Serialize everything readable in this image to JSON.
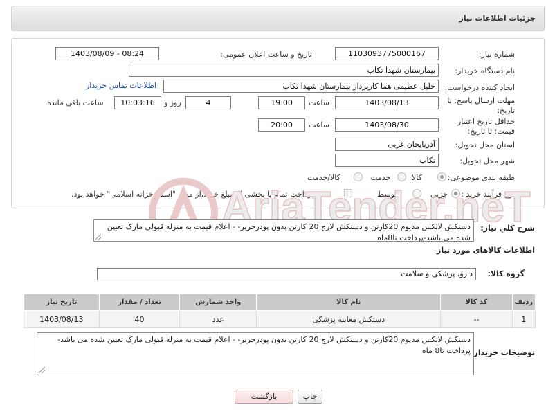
{
  "title": "جزئیات اطلاعات نیاز",
  "fields": {
    "need_number_label": "شماره نیاز:",
    "need_number": "1103093775000167",
    "announce_label": "تاریخ و ساعت اعلان عمومی:",
    "announce_value": "1403/08/09 - 08:24",
    "buyer_label": "نام دستگاه خریدار:",
    "buyer_value": "بیمارستان شهدا تکاب",
    "creator_label": "ایجاد کننده درخواست:",
    "creator_value": "خلیل عظیمی هما کارپرداز بیمارستان شهدا تکاب",
    "contact_link": "اطلاعات تماس خریدار",
    "reply_deadline_label": "مهلت ارسال پاسخ: تا تاریخ:",
    "reply_date": "1403/08/13",
    "time_label": "ساعت",
    "reply_time": "19:00",
    "days_value": "4",
    "days_label": "روز و",
    "remaining_time": "10:03:16",
    "remaining_label": "ساعت باقی مانده",
    "min_validity_label": "حداقل تاریخ اعتبار قیمت: تا تاریخ:",
    "validity_date": "1403/08/30",
    "validity_time": "20:00",
    "province_label": "استان محل تحویل:",
    "province_value": "آذربایجان غربی",
    "city_label": "شهر محل تحویل:",
    "city_value": "تکاب",
    "category_label": "طبقه بندی موضوعی:",
    "category_options": [
      "کالا",
      "خدمت",
      "کالا/خدمت"
    ],
    "process_label": "نوع فرآیند خرید :",
    "process_options": [
      "جزیی",
      "متوسط"
    ],
    "payment_note": "پرداخت تمام یا بخشی از مبلغ خرید،از محل \"اسناد خزانه اسلامی\" خواهد بود."
  },
  "general_desc": {
    "label": "شرح کلي نياز:",
    "text": "دستکش لاتکس مدیوم  20کارتن  و دستکش لارج 20 کارتن بدون پودرحریر- - اعلام قیمت به منزله قبولی مارک تعیین شده  می باشد-پرداخت تا8ماه"
  },
  "goods_header": "اطلاعات کالاهای مورد نیاز",
  "goods_group": {
    "label": "گروه کالا:",
    "value": "دارو، پزشکی و سلامت"
  },
  "table": {
    "headers": [
      "ردیف",
      "کد کالا",
      "نام کالا",
      "واحد شمارش",
      "تعداد / مقدار",
      "تاریخ نیاز"
    ],
    "rows": [
      [
        "1",
        "--",
        "دستکش معاینه پزشکی",
        "عدد",
        "40",
        "1403/08/13"
      ]
    ]
  },
  "buyer_desc": {
    "label": "توضیحات خریدار:",
    "text": "دستکش لاتکس مدیوم  20کارتن  و دستکش لارج 20 کارتن بدون پودرحریر- - اعلام قیمت به منزله قبولی مارک تعیین شده  می باشد-پرداخت تا8 ماه"
  },
  "buttons": {
    "print": "چاپ",
    "back": "بازگشت"
  },
  "watermark": {
    "text": "AriaTender.neT"
  },
  "colors": {
    "link": "#1a4ea8",
    "table_header": "#cbcbcb",
    "watermark": "#e9c9c9"
  }
}
